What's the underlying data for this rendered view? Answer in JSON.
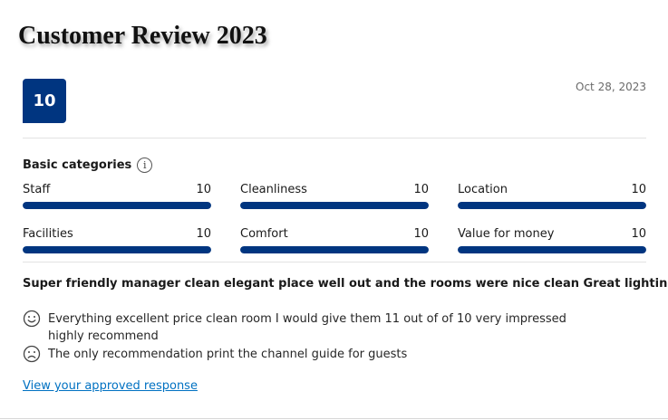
{
  "page": {
    "title": "Customer Review 2023"
  },
  "review": {
    "score": "10",
    "date": "Oct 28, 2023",
    "headline": "Super friendly manager clean elegant place well out and the rooms were nice clean Great lighting",
    "positive_text": "Everything excellent price clean room I would give them 11 out of of 10 very impressed highly recommend",
    "negative_text": "The only recommendation print the channel guide for guests",
    "approved_link": "View your approved response"
  },
  "categories": {
    "heading": "Basic categories",
    "info_icon": "info-icon",
    "items": [
      {
        "label": "Staff",
        "score": "10",
        "fraction": 1.0
      },
      {
        "label": "Cleanliness",
        "score": "10",
        "fraction": 1.0
      },
      {
        "label": "Location",
        "score": "10",
        "fraction": 1.0
      },
      {
        "label": "Facilities",
        "score": "10",
        "fraction": 1.0
      },
      {
        "label": "Comfort",
        "score": "10",
        "fraction": 1.0
      },
      {
        "label": "Value for money",
        "score": "10",
        "fraction": 1.0
      }
    ]
  },
  "colors": {
    "brand": "#003580",
    "link": "#0071c2",
    "bar_track": "#e7e7e7"
  },
  "icons": {
    "positive": "smile-face-icon",
    "negative": "frown-face-icon"
  }
}
